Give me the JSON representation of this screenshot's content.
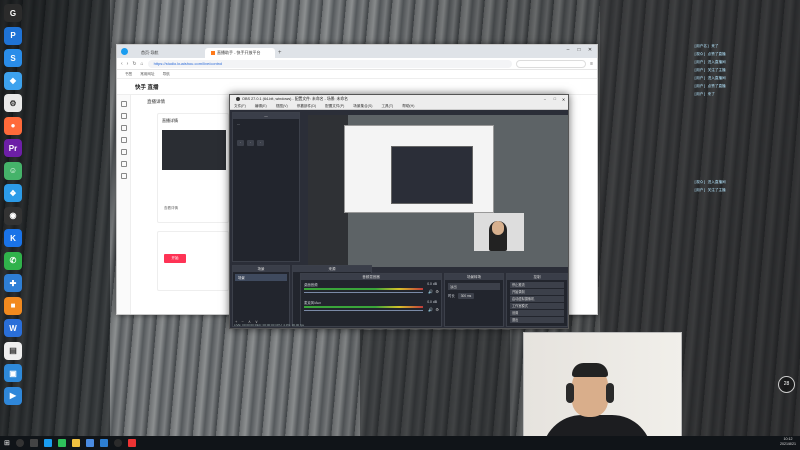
{
  "desktop": {
    "icons": [
      {
        "label": "",
        "color": "#2b2b2b",
        "glyph": "G"
      },
      {
        "label": "",
        "color": "#1f73d6",
        "glyph": "P"
      },
      {
        "label": "",
        "color": "#2a8de9",
        "glyph": "S"
      },
      {
        "label": "",
        "color": "#3da2ee",
        "glyph": "◆"
      },
      {
        "label": "",
        "color": "#e9e9e9",
        "glyph": "⚙"
      },
      {
        "label": "",
        "color": "#ff6a3a",
        "glyph": "●"
      },
      {
        "label": "",
        "color": "#6d1fa7",
        "glyph": "Pr"
      },
      {
        "label": "",
        "color": "#45b36a",
        "glyph": "☺"
      },
      {
        "label": "",
        "color": "#2c9be8",
        "glyph": "❖"
      },
      {
        "label": "",
        "color": "#333",
        "glyph": "◉"
      },
      {
        "label": "",
        "color": "#1a73e8",
        "glyph": "K"
      },
      {
        "label": "",
        "color": "#30b24b",
        "glyph": "✆"
      },
      {
        "label": "",
        "color": "#2e7fd6",
        "glyph": "✚"
      },
      {
        "label": "",
        "color": "#f28a1f",
        "glyph": "■"
      },
      {
        "label": "",
        "color": "#2a6fd9",
        "glyph": "W"
      },
      {
        "label": "",
        "color": "#eeeeee",
        "glyph": "▤"
      },
      {
        "label": "",
        "color": "#2e89d9",
        "glyph": "▣"
      },
      {
        "label": "",
        "color": "#2f87d9",
        "glyph": "▶"
      }
    ],
    "overlay_lines": [
      "[用户名] 来了",
      "[观众] 点赞了直播",
      "[用户] 进入直播间",
      "[用户] 关注了主播",
      "[用户] 进入直播间",
      "[用户] 点赞了直播",
      "[用户] 来了",
      "[观众] 进入直播间",
      "[用户] 关注了主播"
    ],
    "badge": "28"
  },
  "browser": {
    "tabs": [
      {
        "label": "首页·导航",
        "active": false
      },
      {
        "label": "直播助手 - 快手开放平台",
        "active": true
      }
    ],
    "url": "https://studio.kuaishou.com/live/control",
    "bookmarks": [
      "书签",
      "常用网址",
      "导航"
    ],
    "page_title": "快手 直播",
    "section_title": "直播详情",
    "card_title": "直播详情",
    "button_primary": "开始",
    "link_text": "查看详情"
  },
  "obs": {
    "title": "OBS 27.0.1 (64-bit, windows) - 配置文件: 未命名 - 场景: 未命名",
    "menu": [
      "文件(F)",
      "编辑(E)",
      "视图(V)",
      "停靠部件(D)",
      "配置文件(P)",
      "场景集合(S)",
      "工具(T)",
      "帮助(H)"
    ],
    "scenes_head": "场景",
    "sources_head": "来源",
    "mixer_head": "音频混音器",
    "transitions_head": "场景转场",
    "controls_head": "控制",
    "scene_item": "场景",
    "mixer_tracks": [
      {
        "name": "桌面音频",
        "db": "0.0 dB"
      },
      {
        "name": "麦克风/Aux",
        "db": "0.0 dB"
      }
    ],
    "transition_name": "淡出",
    "duration_label": "时长",
    "duration_value": "300 ms",
    "controls": [
      "停止推流",
      "开始录制",
      "启动虚拟摄像机",
      "工作室模式",
      "设置",
      "退出"
    ],
    "status": "LIVE: 00:00:00  REC: 00:00:00  CPU: 4.3%, 30.00 fps"
  },
  "taskbar": {
    "time": "10:12",
    "date": "2021/8/21"
  }
}
